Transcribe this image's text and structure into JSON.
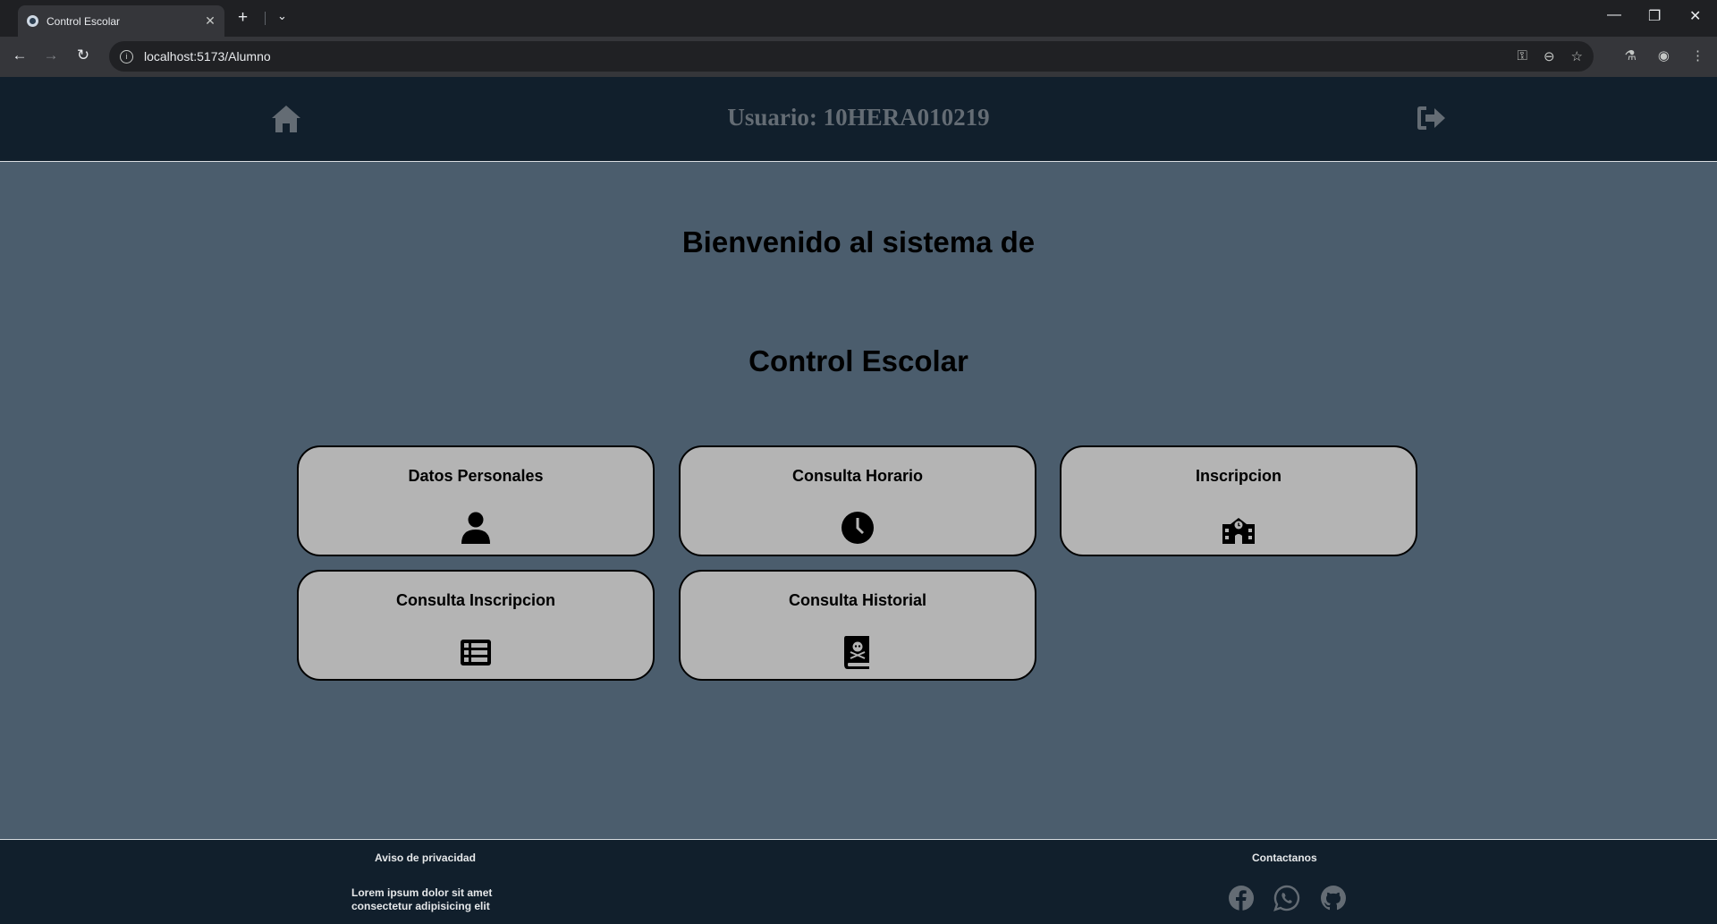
{
  "browser": {
    "tab_title": "Control Escolar",
    "tab_close": "✕",
    "new_tab": "+",
    "tab_list": "⌄",
    "url": "localhost:5173/Alumno",
    "window_controls": {
      "minimize": "—",
      "restore": "❐",
      "close": "✕"
    }
  },
  "header": {
    "user_label": "Usuario: 10HERA010219",
    "home_icon": "home-icon",
    "logout_icon": "logout-icon"
  },
  "main": {
    "welcome_line1": "Bienvenido al sistema de",
    "welcome_line2": "Control Escolar",
    "cards": [
      {
        "label": "Datos Personales",
        "icon": "user-icon"
      },
      {
        "label": "Consulta Horario",
        "icon": "clock-icon"
      },
      {
        "label": "Inscripcion",
        "icon": "school-icon"
      },
      {
        "label": "Consulta Inscripcion",
        "icon": "list-icon"
      },
      {
        "label": "Consulta Historial",
        "icon": "book-skull-icon"
      }
    ]
  },
  "footer": {
    "privacy_title": "Aviso de privacidad",
    "privacy_text_line1": "Lorem ipsum dolor sit amet",
    "privacy_text_line2": "consectetur adipisicing elit",
    "contact_title": "Contactanos",
    "social_icons": [
      "facebook-icon",
      "whatsapp-icon",
      "github-icon"
    ]
  },
  "colors": {
    "page_bg": "#4b5d6d",
    "header_bg": "#111f2c",
    "card_bg": "#b4b4b4",
    "muted_icon": "#646c74"
  }
}
